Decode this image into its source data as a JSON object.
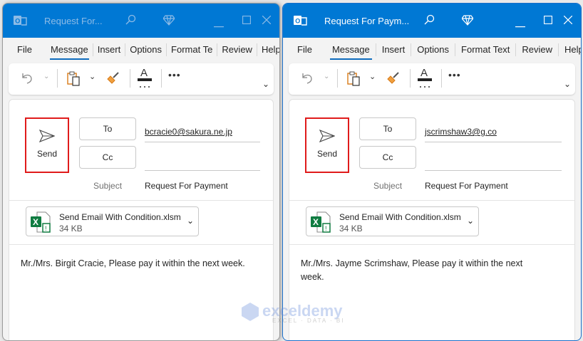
{
  "windows": [
    {
      "title": "Request For...",
      "tabs": [
        "File",
        "Message",
        "Insert",
        "Options",
        "Format Te",
        "Review",
        "Help"
      ],
      "send_label": "Send",
      "to_label": "To",
      "cc_label": "Cc",
      "to_value": "bcracie0@sakura.ne.jp",
      "cc_value": "",
      "subject_label": "Subject",
      "subject_value": "Request For Payment",
      "attachment": {
        "name": "Send Email With Condition.xlsm",
        "size": "34 KB"
      },
      "body": "Mr./Mrs. Birgit Cracie, Please pay it within the next week."
    },
    {
      "title": "Request For Paym...",
      "tabs": [
        "File",
        "Message",
        "Insert",
        "Options",
        "Format Text",
        "Review",
        "Help"
      ],
      "send_label": "Send",
      "to_label": "To",
      "cc_label": "Cc",
      "to_value": "jscrimshaw3@g.co",
      "cc_value": "",
      "subject_label": "Subject",
      "subject_value": "Request For Payment",
      "attachment": {
        "name": "Send Email With Condition.xlsm",
        "size": "34 KB"
      },
      "body": "Mr./Mrs. Jayme Scrimshaw, Please pay it within the next week."
    }
  ],
  "watermark": {
    "brand": "exceldemy",
    "tagline": "EXCEL · DATA · BI"
  },
  "colors": {
    "titlebar": "#0078d4",
    "highlight": "#e01b1b",
    "accent": "#0f6cbd"
  }
}
